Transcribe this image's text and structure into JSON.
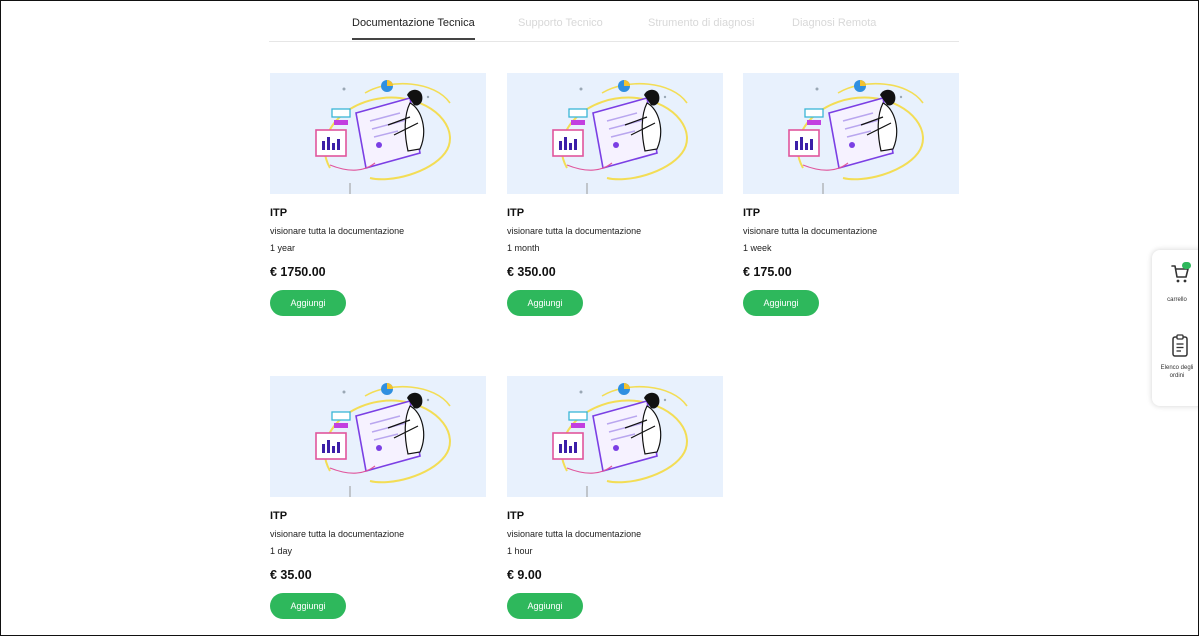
{
  "tabs": [
    {
      "label": "Documentazione Tecnica",
      "active": true
    },
    {
      "label": "Supporto Tecnico",
      "active": false
    },
    {
      "label": "Strumento di diagnosi",
      "active": false
    },
    {
      "label": "Diagnosi Remota",
      "active": false
    }
  ],
  "products": [
    {
      "name": "ITP",
      "description": "visionare tutta la documentazione",
      "duration": "1 year",
      "price": "€ 1750.00",
      "button": "Aggiungi"
    },
    {
      "name": "ITP",
      "description": "visionare tutta la documentazione",
      "duration": "1 month",
      "price": "€ 350.00",
      "button": "Aggiungi"
    },
    {
      "name": "ITP",
      "description": "visionare tutta la documentazione",
      "duration": "1 week",
      "price": "€ 175.00",
      "button": "Aggiungi"
    },
    {
      "name": "ITP",
      "description": "visionare tutta la documentazione",
      "duration": "1 day",
      "price": "€ 35.00",
      "button": "Aggiungi"
    },
    {
      "name": "ITP",
      "description": "visionare tutta la documentazione",
      "duration": "1 hour",
      "price": "€ 9.00",
      "button": "Aggiungi"
    }
  ],
  "sidebar": {
    "cart_label": "carrello",
    "cart_badge": "",
    "orders_label": "Elenco degli ordini"
  },
  "colors": {
    "accent": "#2eb85c",
    "thumb_bg": "#e8f1fd"
  }
}
